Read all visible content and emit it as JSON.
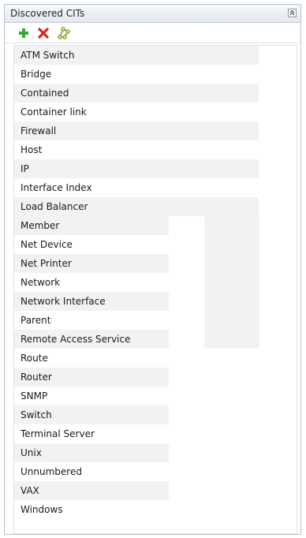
{
  "panel": {
    "title": "Discovered CITs"
  },
  "toolbar": {
    "add_icon": "plus-icon",
    "delete_icon": "delete-x-icon",
    "properties_icon": "topology-icon"
  },
  "items": [
    "ATM Switch",
    "Bridge",
    "Contained",
    "Container link",
    "Firewall",
    "Host",
    "IP",
    "Interface Index",
    "Load Balancer",
    "Member",
    "Net Device",
    "Net Printer",
    "Network",
    "Network Interface",
    "Parent",
    "Remote Access Service",
    "Route",
    "Router",
    "SNMP",
    "Switch",
    "Terminal Server",
    "Unix",
    "Unnumbered",
    "VAX",
    "Windows"
  ],
  "colors": {
    "row_alt": "#f0f2f4",
    "border": "#b9c2cf",
    "add": "#3aa83a",
    "delete": "#d8261b"
  }
}
